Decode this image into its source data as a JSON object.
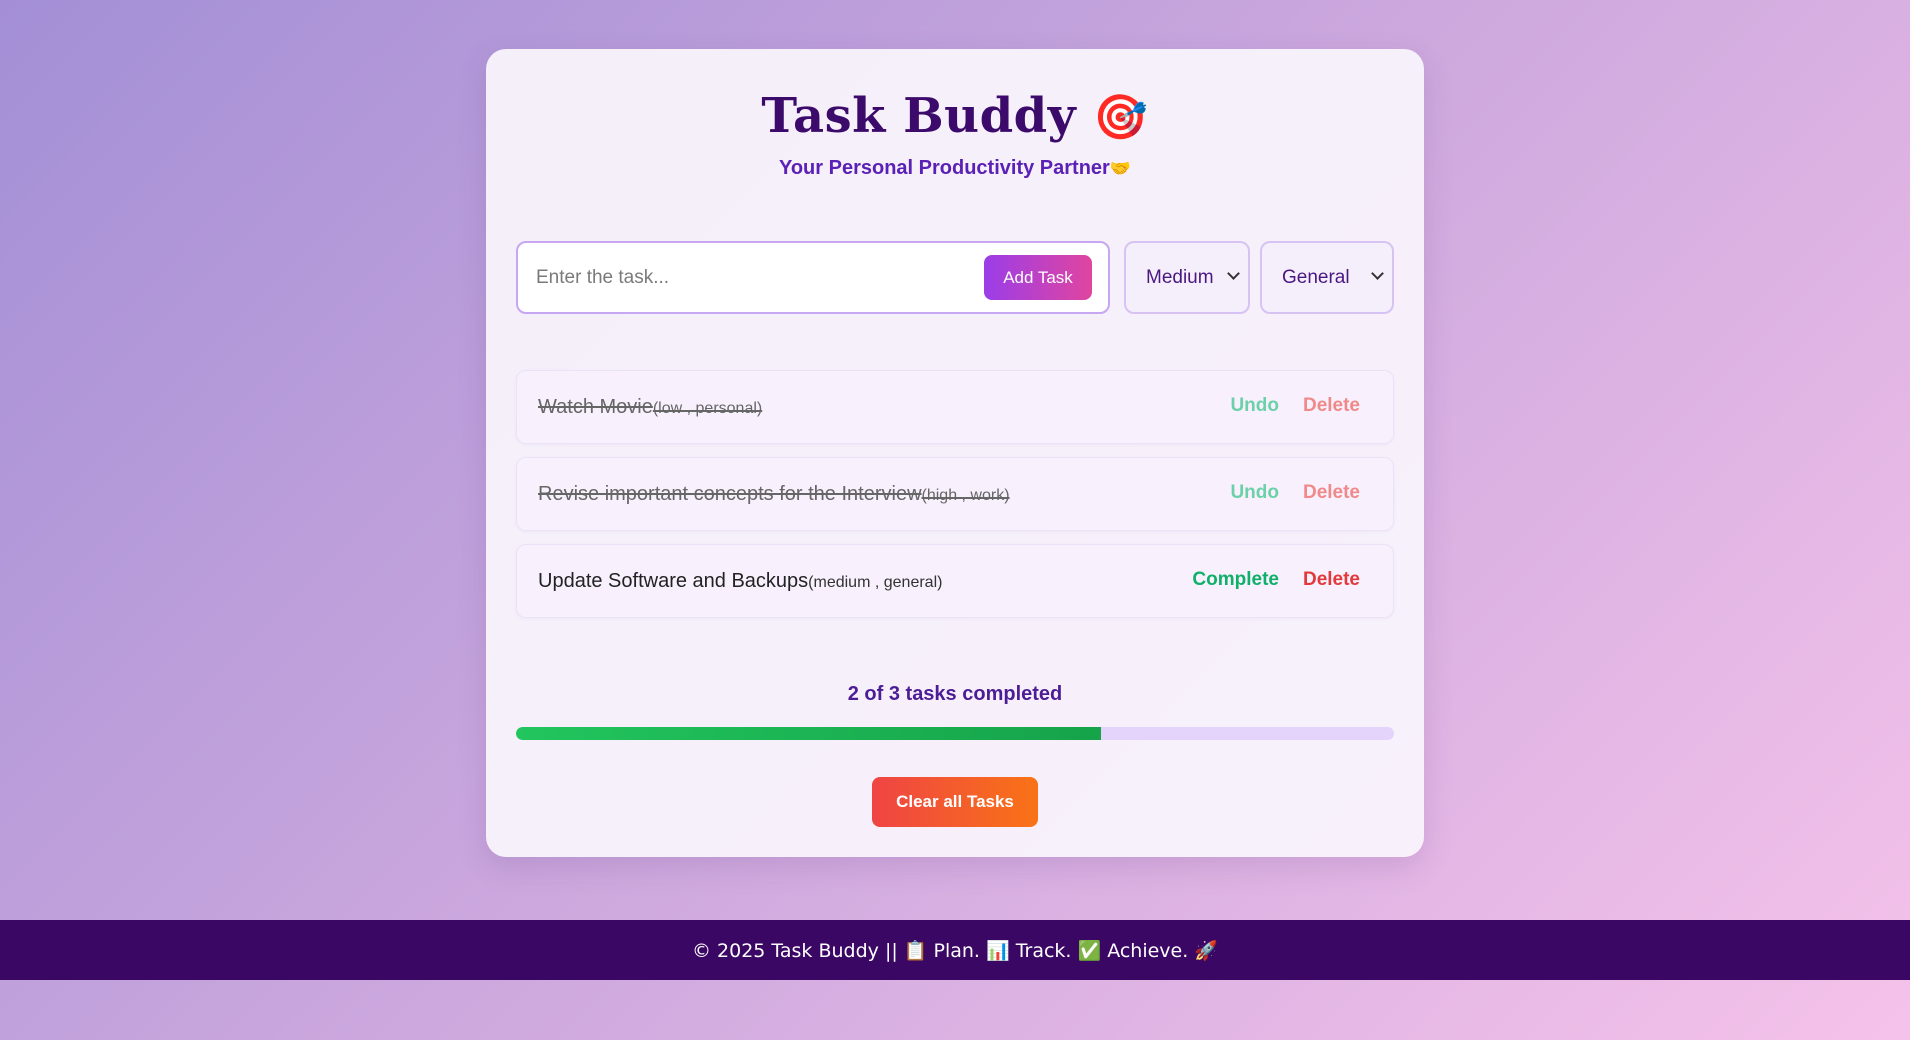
{
  "app": {
    "title": "Task Buddy",
    "title_emoji": "🎯",
    "subtitle": "Your Personal Productivity Partner",
    "subtitle_emoji": "🤝"
  },
  "form": {
    "placeholder": "Enter the task...",
    "value": "",
    "add_label": "Add Task",
    "priority_selected": "Medium",
    "category_selected": "General"
  },
  "tasks": [
    {
      "name": "Watch Movie",
      "meta": "(low , personal)",
      "completed": true,
      "toggle_label": "Undo",
      "delete_label": "Delete"
    },
    {
      "name": "Revise important concepts for the Interview",
      "meta": "(high , work)",
      "completed": true,
      "toggle_label": "Undo",
      "delete_label": "Delete"
    },
    {
      "name": "Update Software and Backups",
      "meta": "(medium , general)",
      "completed": false,
      "toggle_label": "Complete",
      "delete_label": "Delete"
    }
  ],
  "progress": {
    "text": "2 of 3 tasks completed",
    "completed": 2,
    "total": 3
  },
  "clear_label": "Clear all Tasks",
  "footer": {
    "text": "© 2025 Task Buddy || 📋 Plan. 📊 Track. ✅ Achieve. 🚀"
  },
  "colors": {
    "accent_purple": "#5b21b6",
    "title_purple": "#3b0a6b",
    "complete_green": "#10b06a",
    "delete_red": "#e23a3a",
    "progress_green": "#22c55e",
    "footer_bg": "#3b0764"
  }
}
